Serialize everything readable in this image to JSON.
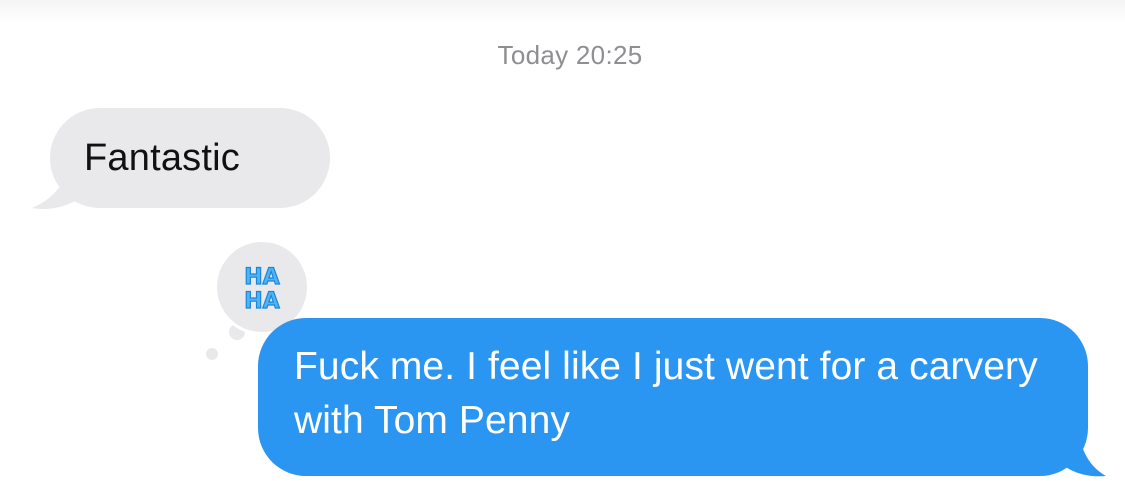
{
  "conversation": {
    "timestamp": "Today 20:25",
    "messages": [
      {
        "direction": "incoming",
        "text": "Fantastic",
        "bubble_color": "#e9e9eb",
        "text_color": "#111111"
      },
      {
        "direction": "outgoing",
        "text": "Fuck me. I feel like I just went for a carvery with Tom Penny",
        "bubble_color": "#2b96f2",
        "text_color": "#ffffff",
        "reaction": {
          "type": "haha",
          "icon": "haha-icon",
          "icon_text_top": "HA",
          "icon_text_bottom": "HA",
          "icon_color": "#4fb4f5"
        }
      }
    ]
  }
}
